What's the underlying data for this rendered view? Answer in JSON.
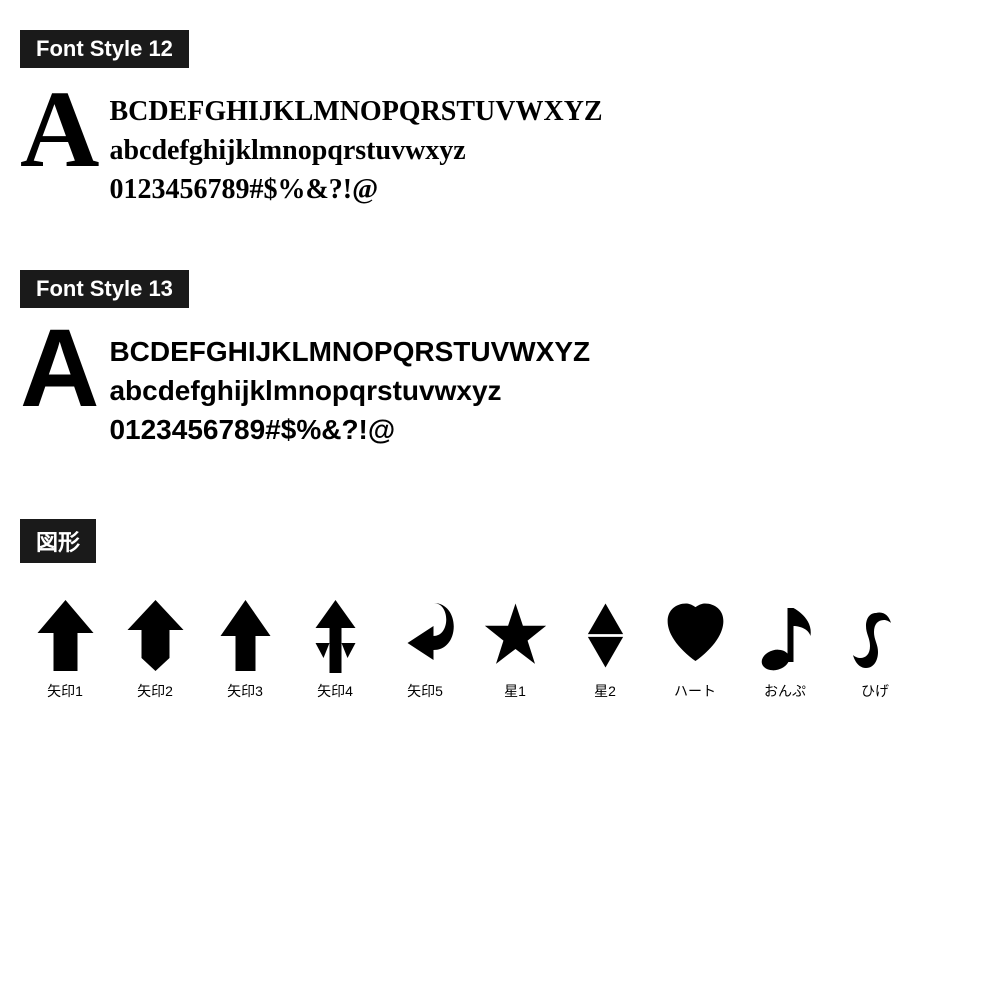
{
  "font12": {
    "label": "Font Style 12",
    "big_letter": "A",
    "line1": "BCDEFGHIJKLMNOPQRSTUVWXYZ",
    "line2": "abcdefghijklmnopqrstuvwxyz",
    "line3": "0123456789#$%&?!@"
  },
  "font13": {
    "label": "Font Style 13",
    "big_letter": "A",
    "line1": "BCDEFGHIJKLMNOPQRSTUVWXYZ",
    "line2": "abcdefghijklmnopqrstuvwxyz",
    "line3": "0123456789#$%&?!@"
  },
  "shapes": {
    "label": "図形",
    "items": [
      {
        "name": "矢印1"
      },
      {
        "name": "矢印2"
      },
      {
        "name": "矢印3"
      },
      {
        "name": "矢印4"
      },
      {
        "name": "矢印5"
      },
      {
        "name": "星1"
      },
      {
        "name": "星2"
      },
      {
        "name": "ハート"
      },
      {
        "name": "おんぷ"
      },
      {
        "name": "ひげ"
      }
    ]
  }
}
